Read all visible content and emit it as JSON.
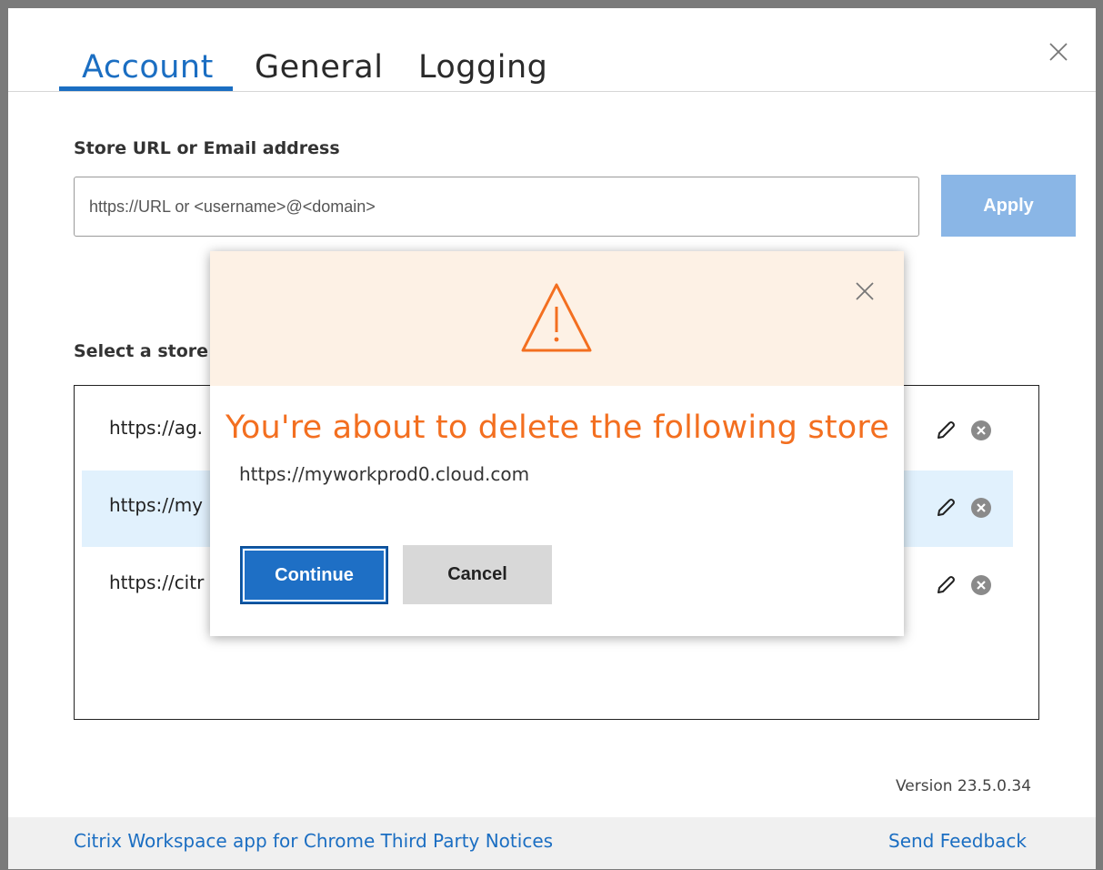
{
  "tabs": [
    {
      "label": "Account",
      "active": true
    },
    {
      "label": "General",
      "active": false
    },
    {
      "label": "Logging",
      "active": false
    }
  ],
  "store_url": {
    "label": "Store URL or Email address",
    "placeholder": "https://URL or <username>@<domain>",
    "value": "",
    "apply_label": "Apply"
  },
  "select_store": {
    "label": "Select a store",
    "stores": [
      {
        "url": "https://ag.",
        "selected": false
      },
      {
        "url": "https://my",
        "selected": true
      },
      {
        "url": "https://citr",
        "selected": false
      }
    ]
  },
  "version": "Version 23.5.0.34",
  "footer": {
    "notices_link": "Citrix Workspace app for Chrome Third Party Notices",
    "feedback_link": "Send Feedback"
  },
  "dialog": {
    "title": "You're about to delete the following store",
    "store_url": "https://myworkprod0.cloud.com",
    "continue_label": "Continue",
    "cancel_label": "Cancel",
    "icon": "warning-icon",
    "accent_color": "#f36f20"
  },
  "colors": {
    "primary": "#1b6ec2",
    "apply_disabled": "#8ab6e6",
    "selected_row": "#e1f1fd",
    "dialog_header": "#fdf1e5"
  }
}
